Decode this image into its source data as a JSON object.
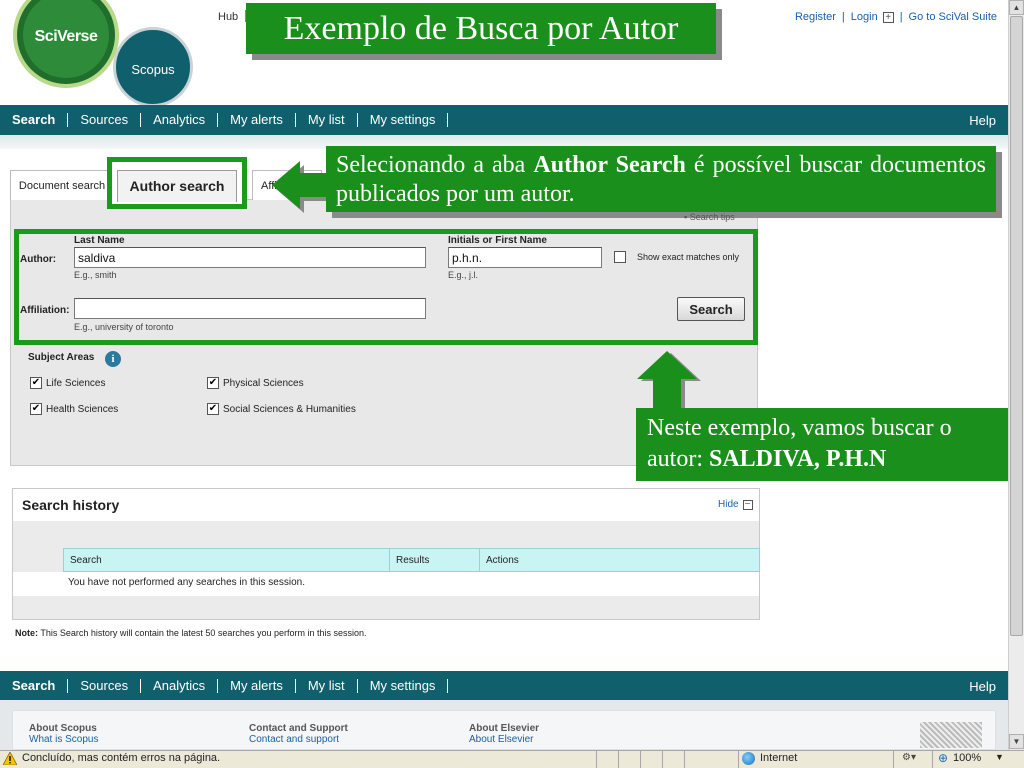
{
  "header": {
    "sciverse_logo": "SciVerse",
    "scopus_logo": "Scopus",
    "hub": "Hub",
    "top_links": {
      "register": "Register",
      "login": "Login",
      "sciVal": "Go to SciVal Suite"
    }
  },
  "title_banner": "Exemplo de Busca por Autor",
  "nav": {
    "items": [
      "Search",
      "Sources",
      "Analytics",
      "My alerts",
      "My list",
      "My settings"
    ],
    "help": "Help"
  },
  "tabs": {
    "document": "Document search",
    "author": "Author search",
    "affiliation": "Affi"
  },
  "callout_1": {
    "pre": "Selecionando a aba ",
    "bold": "Author Search",
    "post": " é possível buscar documentos publicados por um autor."
  },
  "search_tips": "Search tips",
  "form": {
    "author_label": "Author:",
    "last_name_label": "Last Name",
    "last_name_value": "saldiva",
    "last_name_hint": "E.g., smith",
    "initials_label": "Initials or First Name",
    "initials_value": "p.h.n.",
    "initials_hint": "E.g., j.l.",
    "exact_matches": "Show exact matches only",
    "affiliation_label": "Affiliation:",
    "affiliation_value": "",
    "affiliation_hint": "E.g., university of toronto",
    "search_button": "Search"
  },
  "subject_areas": {
    "title": "Subject Areas",
    "items": [
      {
        "label": "Life Sciences",
        "checked": true
      },
      {
        "label": "Physical Sciences",
        "checked": true
      },
      {
        "label": "Health Sciences",
        "checked": true
      },
      {
        "label": "Social Sciences & Humanities",
        "checked": true
      }
    ]
  },
  "callout_2": {
    "pre": "Neste exemplo, vamos buscar o autor: ",
    "bold": "SALDIVA, P.H.N"
  },
  "history": {
    "title": "Search history",
    "hide": "Hide",
    "columns": [
      "Search",
      "Results",
      "Actions"
    ],
    "empty": "You have not performed any searches in this session.",
    "note_label": "Note:",
    "note_text": " This Search history will contain the latest 50 searches you perform in this session."
  },
  "footer": {
    "col1_head": "About Scopus",
    "col1_link": "What is Scopus",
    "col2_head": "Contact and Support",
    "col2_link": "Contact and support",
    "col3_head": "About Elsevier",
    "col3_link": "About Elsevier"
  },
  "status": {
    "text": "Concluído, mas contém erros na página.",
    "zone": "Internet",
    "zoom": "100%"
  },
  "colors": {
    "nav_bg": "#0f5f6d",
    "callout_green": "#1b8f1b",
    "highlight_border": "#1b9a1b"
  }
}
